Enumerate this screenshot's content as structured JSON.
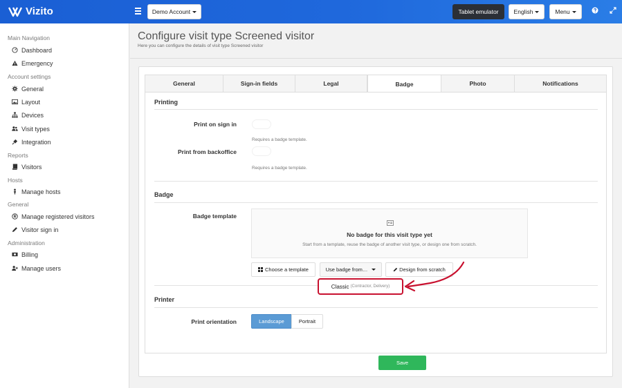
{
  "app": {
    "brand": "Vizito"
  },
  "topbar": {
    "account_label": "Demo Account",
    "tablet_label": "Tablet emulator",
    "language_label": "English",
    "menu_label": "Menu",
    "help_icon": "question-icon",
    "expand_icon": "expand-icon"
  },
  "sidebar": {
    "sections": [
      {
        "title": "Main Navigation",
        "items": [
          {
            "label": "Dashboard",
            "icon": "gauge-icon"
          },
          {
            "label": "Emergency",
            "icon": "warning-icon"
          }
        ]
      },
      {
        "title": "Account settings",
        "items": [
          {
            "label": "General",
            "icon": "gear-icon"
          },
          {
            "label": "Layout",
            "icon": "image-icon"
          },
          {
            "label": "Devices",
            "icon": "sitemap-icon"
          },
          {
            "label": "Visit types",
            "icon": "users-icon"
          },
          {
            "label": "Integration",
            "icon": "plug-icon"
          }
        ]
      },
      {
        "title": "Reports",
        "items": [
          {
            "label": "Visitors",
            "icon": "book-icon"
          }
        ]
      },
      {
        "title": "Hosts",
        "items": [
          {
            "label": "Manage hosts",
            "icon": "person-icon"
          }
        ]
      },
      {
        "title": "General",
        "items": [
          {
            "label": "Manage registered visitors",
            "icon": "registered-icon"
          },
          {
            "label": "Visitor sign in",
            "icon": "pencil-icon"
          }
        ]
      },
      {
        "title": "Administration",
        "items": [
          {
            "label": "Billing",
            "icon": "money-icon"
          },
          {
            "label": "Manage users",
            "icon": "user-plus-icon"
          }
        ]
      }
    ]
  },
  "page": {
    "title": "Configure visit type Screened visitor",
    "subtitle": "Here you can configure the details of visit type Screened visitor"
  },
  "tabs": [
    {
      "label": "General",
      "active": false
    },
    {
      "label": "Sign-in fields",
      "active": false
    },
    {
      "label": "Legal",
      "active": false
    },
    {
      "label": "Badge",
      "active": true
    },
    {
      "label": "Photo",
      "active": false
    },
    {
      "label": "Notifications",
      "active": false
    }
  ],
  "printing": {
    "title": "Printing",
    "print_on_signin_label": "Print on sign in",
    "print_on_signin_hint": "Requires a badge template.",
    "print_on_signin_enabled": false,
    "print_backoffice_label": "Print from backoffice",
    "print_backoffice_hint": "Requires a badge template.",
    "print_backoffice_enabled": false
  },
  "badge": {
    "title": "Badge",
    "template_label": "Badge template",
    "empty_title": "No badge for this visit type yet",
    "empty_sub": "Start from a template, reuse the badge of another visit type, or design one from scratch.",
    "choose_template_label": "Choose a template",
    "use_badge_label": "Use badge from…",
    "design_scratch_label": "Design from scratch",
    "dropdown_option_name": "Classic",
    "dropdown_option_meta": "(Contractor, Delivery)"
  },
  "printer": {
    "title": "Printer",
    "orientation_label": "Print orientation",
    "landscape_label": "Landscape",
    "portrait_label": "Portrait",
    "selected": "Landscape"
  },
  "footer": {
    "save_label": "Save"
  },
  "colors": {
    "topbar": "#1f68dc",
    "save": "#2fb75b",
    "segment_active": "#5b9bd5",
    "highlight": "#c8102e",
    "tablet_button": "#2b2f36"
  }
}
